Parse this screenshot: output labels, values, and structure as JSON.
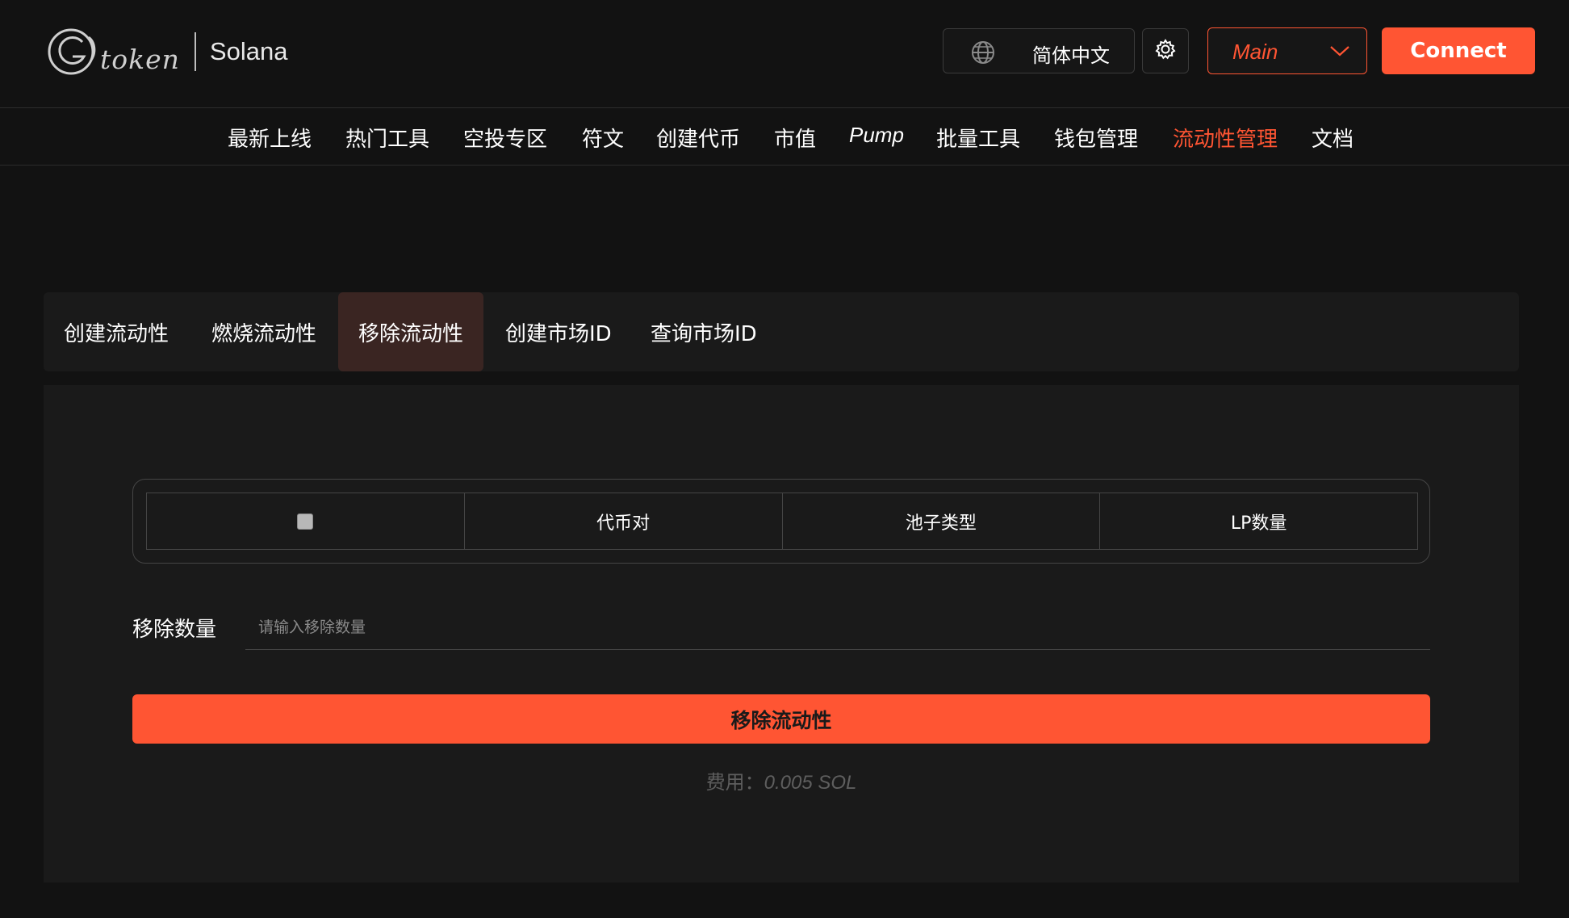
{
  "header": {
    "logo_text": "token",
    "chain": "Solana",
    "language": "简体中文",
    "network": "Main",
    "connect_label": "Connect"
  },
  "nav": {
    "items": [
      {
        "label": "最新上线"
      },
      {
        "label": "热门工具"
      },
      {
        "label": "空投专区"
      },
      {
        "label": "符文"
      },
      {
        "label": "创建代币"
      },
      {
        "label": "市值"
      },
      {
        "label": "Pump"
      },
      {
        "label": "批量工具"
      },
      {
        "label": "钱包管理"
      },
      {
        "label": "流动性管理"
      },
      {
        "label": "文档"
      }
    ],
    "active_index": 9
  },
  "tabs": {
    "items": [
      {
        "label": "创建流动性"
      },
      {
        "label": "燃烧流动性"
      },
      {
        "label": "移除流动性"
      },
      {
        "label": "创建市场ID"
      },
      {
        "label": "查询市场ID"
      }
    ],
    "active_index": 2
  },
  "table": {
    "columns": [
      "代币对",
      "池子类型",
      "LP数量"
    ]
  },
  "form": {
    "amount_label": "移除数量",
    "amount_placeholder": "请输入移除数量",
    "amount_value": "",
    "submit_label": "移除流动性",
    "fee_label": "费用：",
    "fee_value": "0.005 SOL"
  },
  "colors": {
    "accent": "#ff5533",
    "background": "#121212",
    "panel": "#1a1a1a",
    "active_tab": "#3a2522"
  },
  "icons": {
    "language": "globe-icon",
    "settings": "gear-icon",
    "network_dropdown": "chevron-down-icon"
  }
}
